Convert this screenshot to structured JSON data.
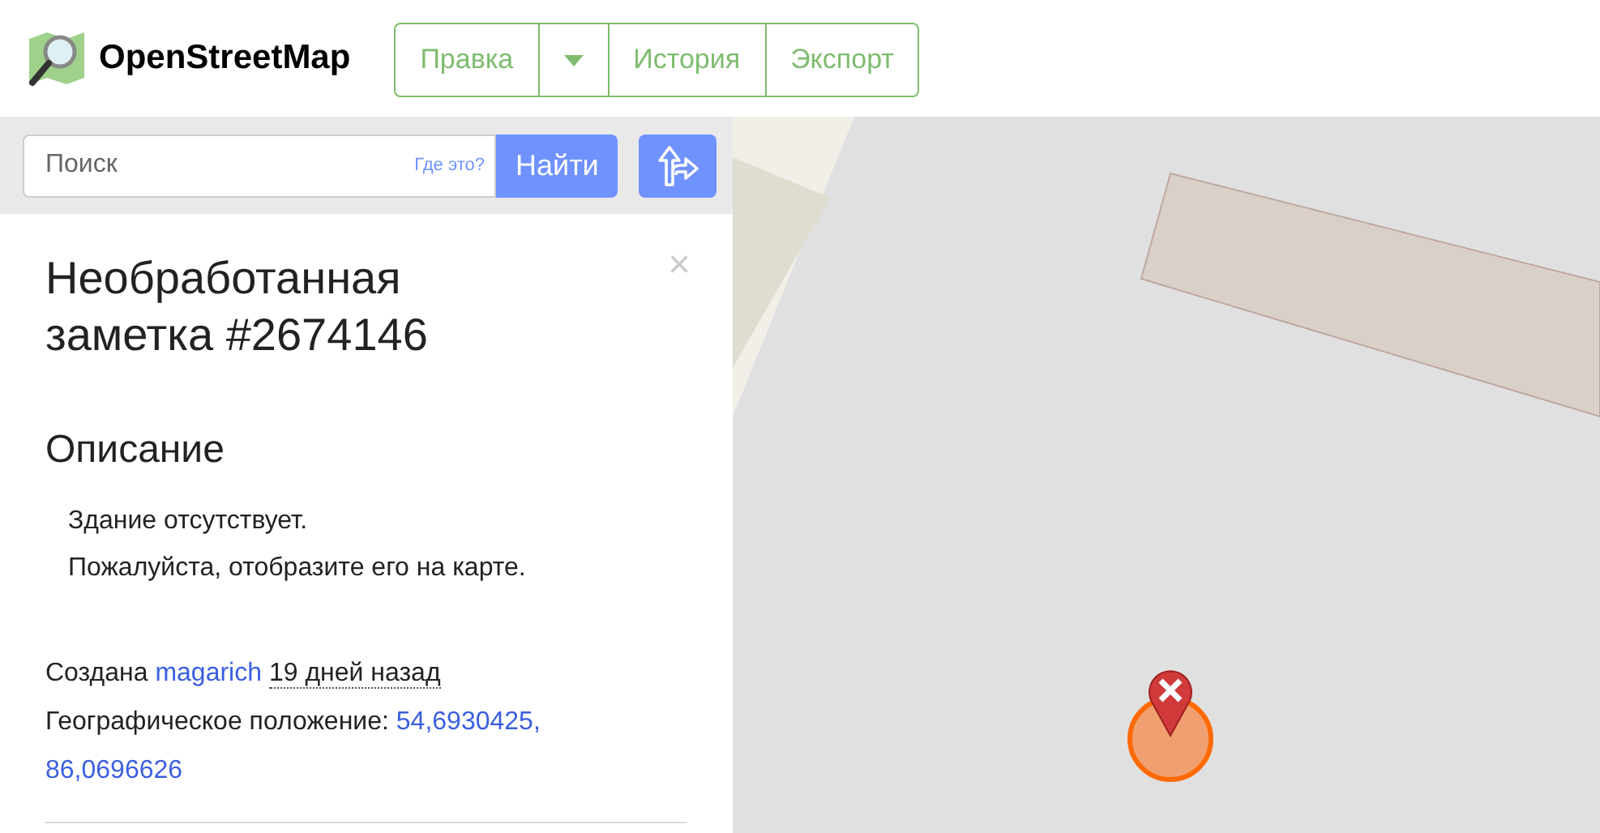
{
  "header": {
    "logo_text": "OpenStreetMap",
    "nav": [
      {
        "label": "Правка",
        "kind": "button"
      },
      {
        "kind": "dropdown"
      },
      {
        "label": "История",
        "kind": "button"
      },
      {
        "label": "Экспорт",
        "kind": "button"
      }
    ]
  },
  "search": {
    "placeholder": "Поиск",
    "where_link": "Где это?",
    "button": "Найти"
  },
  "note": {
    "title": "Необработанная заметка #2674146",
    "close": "×",
    "section": "Описание",
    "description": [
      "Здание отсутствует.",
      "Пожалуйста, отобразите его на карте."
    ],
    "created_prefix": "Создана",
    "user": "magarich",
    "time": "19 дней назад",
    "location_label": "Географическое положение:",
    "location": [
      "54,6930425,",
      "86,0696626"
    ]
  }
}
